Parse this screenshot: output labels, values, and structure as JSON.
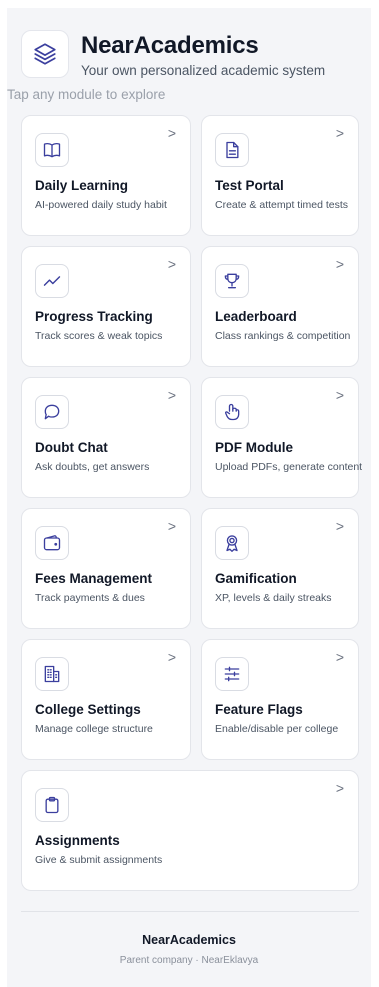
{
  "header": {
    "title": "NearAcademics",
    "subtitle": "Your own personalized academic system",
    "logo_icon": "stacked-layers-icon"
  },
  "hint": "Tap any module to explore",
  "modules": [
    {
      "title": "Daily Learning",
      "desc": "AI-powered daily study habit",
      "icon": "open-book-icon"
    },
    {
      "title": "Test Portal",
      "desc": "Create & attempt timed tests",
      "icon": "document-icon"
    },
    {
      "title": "Progress Tracking",
      "desc": "Track scores & weak topics",
      "icon": "trend-line-icon"
    },
    {
      "title": "Leaderboard",
      "desc": "Class rankings & competition",
      "icon": "trophy-icon"
    },
    {
      "title": "Doubt Chat",
      "desc": "Ask doubts, get answers",
      "icon": "chat-bubble-icon"
    },
    {
      "title": "PDF Module",
      "desc": "Upload PDFs, generate content",
      "icon": "hand-pointer-icon"
    },
    {
      "title": "Fees Management",
      "desc": "Track payments & dues",
      "icon": "wallet-icon"
    },
    {
      "title": "Gamification",
      "desc": "XP, levels & daily streaks",
      "icon": "award-ribbon-icon"
    },
    {
      "title": "College Settings",
      "desc": "Manage college structure",
      "icon": "building-icon"
    },
    {
      "title": "Feature Flags",
      "desc": "Enable/disable per college",
      "icon": "sliders-icon"
    },
    {
      "title": "Assignments",
      "desc": "Give & submit assignments",
      "icon": "clipboard-icon"
    }
  ],
  "chevron": ">",
  "footer": {
    "title": "NearAcademics",
    "subtitle": "Parent company · NearEklavya"
  },
  "colors": {
    "accent": "#3b3f9e",
    "background": "#f4f5f8",
    "card": "#ffffff"
  }
}
